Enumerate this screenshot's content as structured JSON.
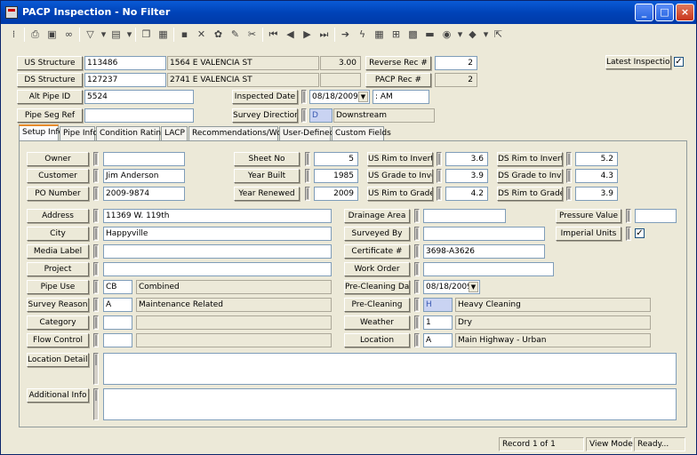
{
  "window": {
    "title": "PACP Inspection - No Filter",
    "min": "_",
    "max": "□",
    "close": "×"
  },
  "toolbar": {
    "icons": [
      "grip-icon",
      "print-icon",
      "preview-icon",
      "binoculars-icon",
      "filter-icon",
      "dropdown-arrow-icon",
      "report-icon",
      "dropdown-arrow-icon",
      "copy-icon",
      "paste-icon",
      "save-icon",
      "delete-icon",
      "settings-icon",
      "edit-icon",
      "cut-icon",
      "first-record-icon",
      "prev-record-icon",
      "next-record-icon",
      "last-record-icon",
      "goto-icon",
      "lightning-icon",
      "grid-icon",
      "structure-icon",
      "image-icon",
      "video-icon",
      "globe-icon",
      "dropdown-arrow-icon",
      "book-icon",
      "dropdown-arrow-icon",
      "export-icon"
    ]
  },
  "header": {
    "us_structure_label": "US Structure",
    "us_structure_id": "113486",
    "us_structure_addr": "1564  E VALENCIA ST",
    "us_structure_val": "3.00",
    "ds_structure_label": "DS Structure",
    "ds_structure_id": "127237",
    "ds_structure_addr": "2741  E VALENCIA ST",
    "ds_structure_val": "",
    "reverse_rec_label": "Reverse Rec #",
    "reverse_rec": "2",
    "pacp_rec_label": "PACP Rec #",
    "pacp_rec": "2",
    "latest_inspection_label": "Latest Inspection",
    "latest_inspection_checked": "✓",
    "alt_pipe_id_label": "Alt Pipe ID",
    "alt_pipe_id": "5524",
    "inspected_date_label": "Inspected Date",
    "inspected_date": "08/18/2009",
    "inspected_time": ":  AM",
    "pipe_seg_ref_label": "Pipe Seg Ref",
    "pipe_seg_ref": "",
    "survey_direction_label": "Survey Direction",
    "survey_direction_code": "D",
    "survey_direction": "Downstream"
  },
  "tabs": [
    "Setup Info",
    "Pipe Info",
    "Condition Ratings",
    "LACP",
    "Recommendations/Work",
    "User-Defined",
    "Custom Fields"
  ],
  "setup": {
    "owner_label": "Owner",
    "owner": "",
    "customer_label": "Customer",
    "customer": "Jim Anderson",
    "po_number_label": "PO Number",
    "po_number": "2009-9874",
    "sheet_no_label": "Sheet No",
    "sheet_no": "5",
    "year_built_label": "Year Built",
    "year_built": "1985",
    "year_renewed_label": "Year Renewed",
    "year_renewed": "2009",
    "us_rim_invert_label": "US Rim to Invert",
    "us_rim_invert": "3.6",
    "us_grade_invert_label": "US Grade to Invert",
    "us_grade_invert": "3.9",
    "us_rim_grade_label": "US Rim to Grade",
    "us_rim_grade": "4.2",
    "ds_rim_invert_label": "DS Rim to Invert",
    "ds_rim_invert": "5.2",
    "ds_grade_invert_label": "DS Grade to Invert",
    "ds_grade_invert": "4.3",
    "ds_rim_grade_label": "DS Rim to Grade",
    "ds_rim_grade": "3.9",
    "address_label": "Address",
    "address": "11369 W. 119th",
    "city_label": "City",
    "city": "Happyville",
    "media_label_label": "Media Label",
    "media_label": "",
    "project_label": "Project",
    "project": "",
    "pipe_use_label": "Pipe Use",
    "pipe_use_code": "CB",
    "pipe_use": "Combined",
    "survey_reason_label": "Survey Reason",
    "survey_reason_code": "A",
    "survey_reason": "Maintenance Related",
    "category_label": "Category",
    "category_code": "",
    "category": "",
    "flow_control_label": "Flow Control",
    "flow_control_code": "",
    "flow_control": "",
    "location_details_label": "Location Details",
    "location_details": "",
    "additional_info_label": "Additional Info",
    "additional_info": "",
    "drainage_area_label": "Drainage Area",
    "drainage_area": "",
    "surveyed_by_label": "Surveyed By",
    "surveyed_by": "",
    "certificate_label": "Certificate #",
    "certificate": "3698-A3626",
    "work_order_label": "Work Order",
    "work_order": "",
    "pre_cleaning_date_label": "Pre-Cleaning Date",
    "pre_cleaning_date": "08/18/2009",
    "pre_cleaning_label": "Pre-Cleaning",
    "pre_cleaning_code": "H",
    "pre_cleaning": "Heavy Cleaning",
    "weather_label": "Weather",
    "weather_code": "1",
    "weather": "Dry",
    "location_label": "Location",
    "location_code": "A",
    "location": "Main Highway - Urban",
    "pressure_value_label": "Pressure Value",
    "pressure_value": "",
    "imperial_units_label": "Imperial Units",
    "imperial_units_checked": "✓"
  },
  "status": {
    "record": "Record 1 of 1",
    "mode": "View Mode",
    "state": "Ready..."
  }
}
